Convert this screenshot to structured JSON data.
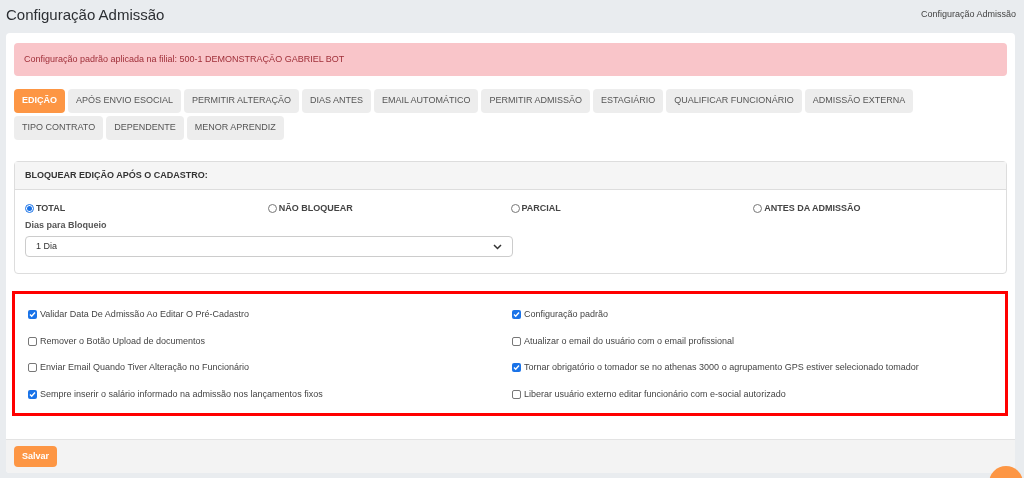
{
  "page_title": "Configuração Admissão",
  "breadcrumb": "Configuração Admissão",
  "alert": "Configuração padrão aplicada na filial: 500-1 DEMONSTRAÇÃO GABRIEL BOT",
  "tabs": [
    {
      "label": "EDIÇÃO",
      "selected": true
    },
    {
      "label": "APÓS ENVIO ESOCIAL",
      "selected": false
    },
    {
      "label": "PERMITIR ALTERAÇÃO",
      "selected": false
    },
    {
      "label": "DIAS ANTES",
      "selected": false
    },
    {
      "label": "EMAIL AUTOMÁTICO",
      "selected": false
    },
    {
      "label": "PERMITIR ADMISSÃO",
      "selected": false
    },
    {
      "label": "ESTAGIÁRIO",
      "selected": false
    },
    {
      "label": "QUALIFICAR FUNCIONÁRIO",
      "selected": false
    },
    {
      "label": "ADMISSÃO EXTERNA",
      "selected": false
    },
    {
      "label": "TIPO CONTRATO",
      "selected": false
    },
    {
      "label": "DEPENDENTE",
      "selected": false
    },
    {
      "label": "MENOR APRENDIZ",
      "selected": false
    }
  ],
  "block_panel": {
    "title": "BLOQUEAR EDIÇÃO APÓS O CADASTRO:",
    "options": [
      {
        "label": "TOTAL",
        "selected": true
      },
      {
        "label": "NÃO BLOQUEAR",
        "selected": false
      },
      {
        "label": "PARCIAL",
        "selected": false
      },
      {
        "label": "ANTES DA ADMISSÃO",
        "selected": false
      }
    ],
    "days_label": "Dias para Bloqueio",
    "days_value": "1 Dia"
  },
  "checkboxes": [
    {
      "label": "Validar Data De Admissão Ao Editar O Pré-Cadastro",
      "checked": true
    },
    {
      "label": "Configuração padrão",
      "checked": true
    },
    {
      "label": "Remover o Botão Upload de documentos",
      "checked": false
    },
    {
      "label": "Atualizar o email do usuário com o email profissional",
      "checked": false
    },
    {
      "label": "Enviar Email Quando Tiver Alteração no Funcionário",
      "checked": false
    },
    {
      "label": "Tornar obrigatório o tomador se no athenas 3000 o agrupamento GPS estiver selecionado tomador",
      "checked": true
    },
    {
      "label": "Sempre inserir o salário informado na admissão nos lançamentos fixos",
      "checked": true
    },
    {
      "label": "Liberar usuário externo editar funcionário com e-social autorizado",
      "checked": false
    }
  ],
  "save_button": "Salvar"
}
